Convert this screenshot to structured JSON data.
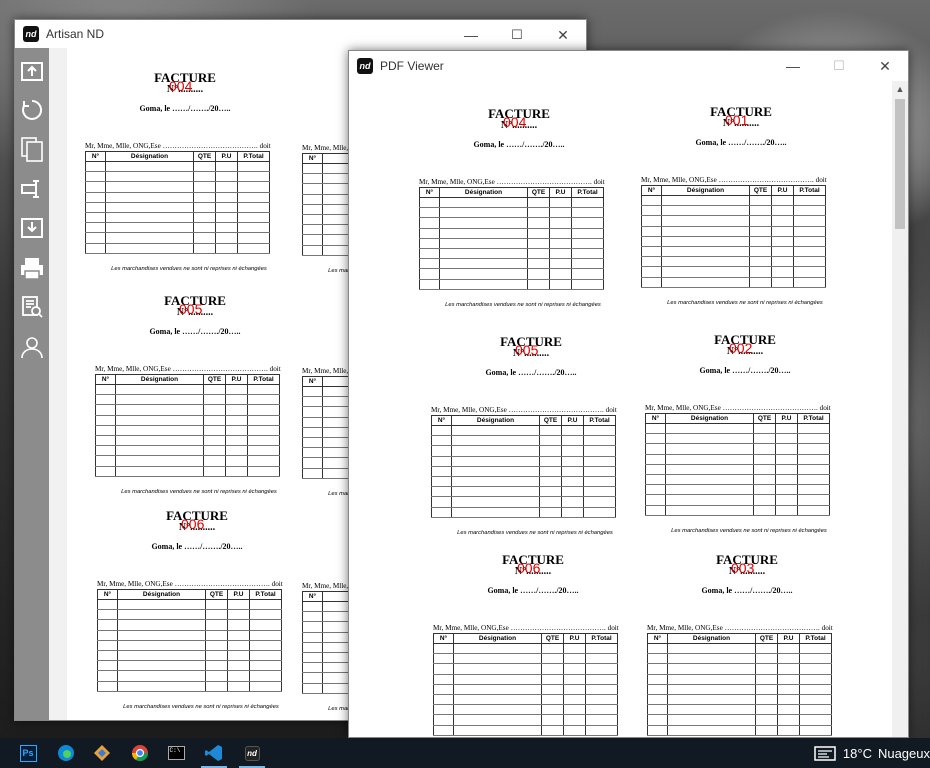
{
  "artisan": {
    "title": "Artisan ND",
    "logo": "nd",
    "controls": {
      "minimize": "—",
      "maximize": "☐",
      "close": "✕"
    }
  },
  "pdf": {
    "title": "PDF Viewer",
    "logo": "nd",
    "controls": {
      "minimize": "—",
      "maximize": "☐",
      "close": "✕"
    }
  },
  "sidebar_icons": [
    "upload-icon",
    "refresh-icon",
    "copy-icon",
    "rename-icon",
    "download-icon",
    "print-icon",
    "preview-icon",
    "user-icon"
  ],
  "invoice_common": {
    "title": "FACTURE",
    "num_label": "N°..........",
    "date": "Goma, le ……/……./20…..",
    "client": "Mr, Mme, Mlle, ONG,Ese …………………………………. doit",
    "columns": [
      "N°",
      "Désignation",
      "QTE",
      "P.U",
      "P.Total"
    ],
    "footer": "Les marchandises vendues ne sont ni reprises ni échangées"
  },
  "artisan_invoices": [
    "004",
    "005",
    "006"
  ],
  "pdf_invoices": [
    "004",
    "001",
    "005",
    "002",
    "006",
    "003"
  ],
  "taskbar": {
    "apps": [
      "photoshop-icon",
      "edge-icon",
      "git-icon",
      "chrome-icon",
      "terminal-icon",
      "vscode-icon",
      "artisan-nd-icon"
    ],
    "temperature": "18°C",
    "weather": "Nuageux"
  },
  "colors": {
    "invoice_number": "#e00000",
    "sidebar": "#8c8c8c",
    "taskbar": "#111a22"
  }
}
